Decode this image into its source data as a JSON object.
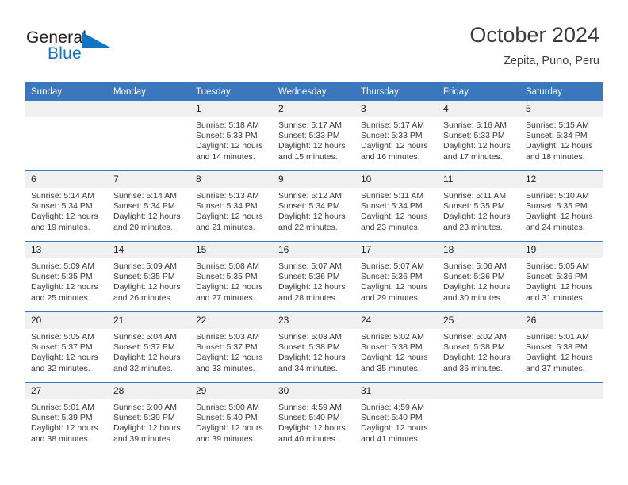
{
  "brand": {
    "word1": "General",
    "word2": "Blue",
    "logo_icon": "blue-triangle-logo",
    "accent_color": "#1273c4"
  },
  "header": {
    "month_title": "October 2024",
    "location": "Zepita, Puno, Peru",
    "header_bg_color": "#3b77bd",
    "daynum_bg_color": "#f0f0f0"
  },
  "weekday_headers": [
    "Sunday",
    "Monday",
    "Tuesday",
    "Wednesday",
    "Thursday",
    "Friday",
    "Saturday"
  ],
  "weeks": [
    [
      {
        "day": "",
        "sunrise": "",
        "sunset": "",
        "daylight1": "",
        "daylight2": "",
        "empty": true
      },
      {
        "day": "",
        "sunrise": "",
        "sunset": "",
        "daylight1": "",
        "daylight2": "",
        "empty": true
      },
      {
        "day": "1",
        "sunrise": "Sunrise: 5:18 AM",
        "sunset": "Sunset: 5:33 PM",
        "daylight1": "Daylight: 12 hours",
        "daylight2": "and 14 minutes."
      },
      {
        "day": "2",
        "sunrise": "Sunrise: 5:17 AM",
        "sunset": "Sunset: 5:33 PM",
        "daylight1": "Daylight: 12 hours",
        "daylight2": "and 15 minutes."
      },
      {
        "day": "3",
        "sunrise": "Sunrise: 5:17 AM",
        "sunset": "Sunset: 5:33 PM",
        "daylight1": "Daylight: 12 hours",
        "daylight2": "and 16 minutes."
      },
      {
        "day": "4",
        "sunrise": "Sunrise: 5:16 AM",
        "sunset": "Sunset: 5:33 PM",
        "daylight1": "Daylight: 12 hours",
        "daylight2": "and 17 minutes."
      },
      {
        "day": "5",
        "sunrise": "Sunrise: 5:15 AM",
        "sunset": "Sunset: 5:34 PM",
        "daylight1": "Daylight: 12 hours",
        "daylight2": "and 18 minutes."
      }
    ],
    [
      {
        "day": "6",
        "sunrise": "Sunrise: 5:14 AM",
        "sunset": "Sunset: 5:34 PM",
        "daylight1": "Daylight: 12 hours",
        "daylight2": "and 19 minutes."
      },
      {
        "day": "7",
        "sunrise": "Sunrise: 5:14 AM",
        "sunset": "Sunset: 5:34 PM",
        "daylight1": "Daylight: 12 hours",
        "daylight2": "and 20 minutes."
      },
      {
        "day": "8",
        "sunrise": "Sunrise: 5:13 AM",
        "sunset": "Sunset: 5:34 PM",
        "daylight1": "Daylight: 12 hours",
        "daylight2": "and 21 minutes."
      },
      {
        "day": "9",
        "sunrise": "Sunrise: 5:12 AM",
        "sunset": "Sunset: 5:34 PM",
        "daylight1": "Daylight: 12 hours",
        "daylight2": "and 22 minutes."
      },
      {
        "day": "10",
        "sunrise": "Sunrise: 5:11 AM",
        "sunset": "Sunset: 5:34 PM",
        "daylight1": "Daylight: 12 hours",
        "daylight2": "and 23 minutes."
      },
      {
        "day": "11",
        "sunrise": "Sunrise: 5:11 AM",
        "sunset": "Sunset: 5:35 PM",
        "daylight1": "Daylight: 12 hours",
        "daylight2": "and 23 minutes."
      },
      {
        "day": "12",
        "sunrise": "Sunrise: 5:10 AM",
        "sunset": "Sunset: 5:35 PM",
        "daylight1": "Daylight: 12 hours",
        "daylight2": "and 24 minutes."
      }
    ],
    [
      {
        "day": "13",
        "sunrise": "Sunrise: 5:09 AM",
        "sunset": "Sunset: 5:35 PM",
        "daylight1": "Daylight: 12 hours",
        "daylight2": "and 25 minutes."
      },
      {
        "day": "14",
        "sunrise": "Sunrise: 5:09 AM",
        "sunset": "Sunset: 5:35 PM",
        "daylight1": "Daylight: 12 hours",
        "daylight2": "and 26 minutes."
      },
      {
        "day": "15",
        "sunrise": "Sunrise: 5:08 AM",
        "sunset": "Sunset: 5:35 PM",
        "daylight1": "Daylight: 12 hours",
        "daylight2": "and 27 minutes."
      },
      {
        "day": "16",
        "sunrise": "Sunrise: 5:07 AM",
        "sunset": "Sunset: 5:36 PM",
        "daylight1": "Daylight: 12 hours",
        "daylight2": "and 28 minutes."
      },
      {
        "day": "17",
        "sunrise": "Sunrise: 5:07 AM",
        "sunset": "Sunset: 5:36 PM",
        "daylight1": "Daylight: 12 hours",
        "daylight2": "and 29 minutes."
      },
      {
        "day": "18",
        "sunrise": "Sunrise: 5:06 AM",
        "sunset": "Sunset: 5:36 PM",
        "daylight1": "Daylight: 12 hours",
        "daylight2": "and 30 minutes."
      },
      {
        "day": "19",
        "sunrise": "Sunrise: 5:05 AM",
        "sunset": "Sunset: 5:36 PM",
        "daylight1": "Daylight: 12 hours",
        "daylight2": "and 31 minutes."
      }
    ],
    [
      {
        "day": "20",
        "sunrise": "Sunrise: 5:05 AM",
        "sunset": "Sunset: 5:37 PM",
        "daylight1": "Daylight: 12 hours",
        "daylight2": "and 32 minutes."
      },
      {
        "day": "21",
        "sunrise": "Sunrise: 5:04 AM",
        "sunset": "Sunset: 5:37 PM",
        "daylight1": "Daylight: 12 hours",
        "daylight2": "and 32 minutes."
      },
      {
        "day": "22",
        "sunrise": "Sunrise: 5:03 AM",
        "sunset": "Sunset: 5:37 PM",
        "daylight1": "Daylight: 12 hours",
        "daylight2": "and 33 minutes."
      },
      {
        "day": "23",
        "sunrise": "Sunrise: 5:03 AM",
        "sunset": "Sunset: 5:38 PM",
        "daylight1": "Daylight: 12 hours",
        "daylight2": "and 34 minutes."
      },
      {
        "day": "24",
        "sunrise": "Sunrise: 5:02 AM",
        "sunset": "Sunset: 5:38 PM",
        "daylight1": "Daylight: 12 hours",
        "daylight2": "and 35 minutes."
      },
      {
        "day": "25",
        "sunrise": "Sunrise: 5:02 AM",
        "sunset": "Sunset: 5:38 PM",
        "daylight1": "Daylight: 12 hours",
        "daylight2": "and 36 minutes."
      },
      {
        "day": "26",
        "sunrise": "Sunrise: 5:01 AM",
        "sunset": "Sunset: 5:38 PM",
        "daylight1": "Daylight: 12 hours",
        "daylight2": "and 37 minutes."
      }
    ],
    [
      {
        "day": "27",
        "sunrise": "Sunrise: 5:01 AM",
        "sunset": "Sunset: 5:39 PM",
        "daylight1": "Daylight: 12 hours",
        "daylight2": "and 38 minutes."
      },
      {
        "day": "28",
        "sunrise": "Sunrise: 5:00 AM",
        "sunset": "Sunset: 5:39 PM",
        "daylight1": "Daylight: 12 hours",
        "daylight2": "and 39 minutes."
      },
      {
        "day": "29",
        "sunrise": "Sunrise: 5:00 AM",
        "sunset": "Sunset: 5:40 PM",
        "daylight1": "Daylight: 12 hours",
        "daylight2": "and 39 minutes."
      },
      {
        "day": "30",
        "sunrise": "Sunrise: 4:59 AM",
        "sunset": "Sunset: 5:40 PM",
        "daylight1": "Daylight: 12 hours",
        "daylight2": "and 40 minutes."
      },
      {
        "day": "31",
        "sunrise": "Sunrise: 4:59 AM",
        "sunset": "Sunset: 5:40 PM",
        "daylight1": "Daylight: 12 hours",
        "daylight2": "and 41 minutes."
      },
      {
        "day": "",
        "sunrise": "",
        "sunset": "",
        "daylight1": "",
        "daylight2": "",
        "empty": true
      },
      {
        "day": "",
        "sunrise": "",
        "sunset": "",
        "daylight1": "",
        "daylight2": "",
        "empty": true
      }
    ]
  ]
}
